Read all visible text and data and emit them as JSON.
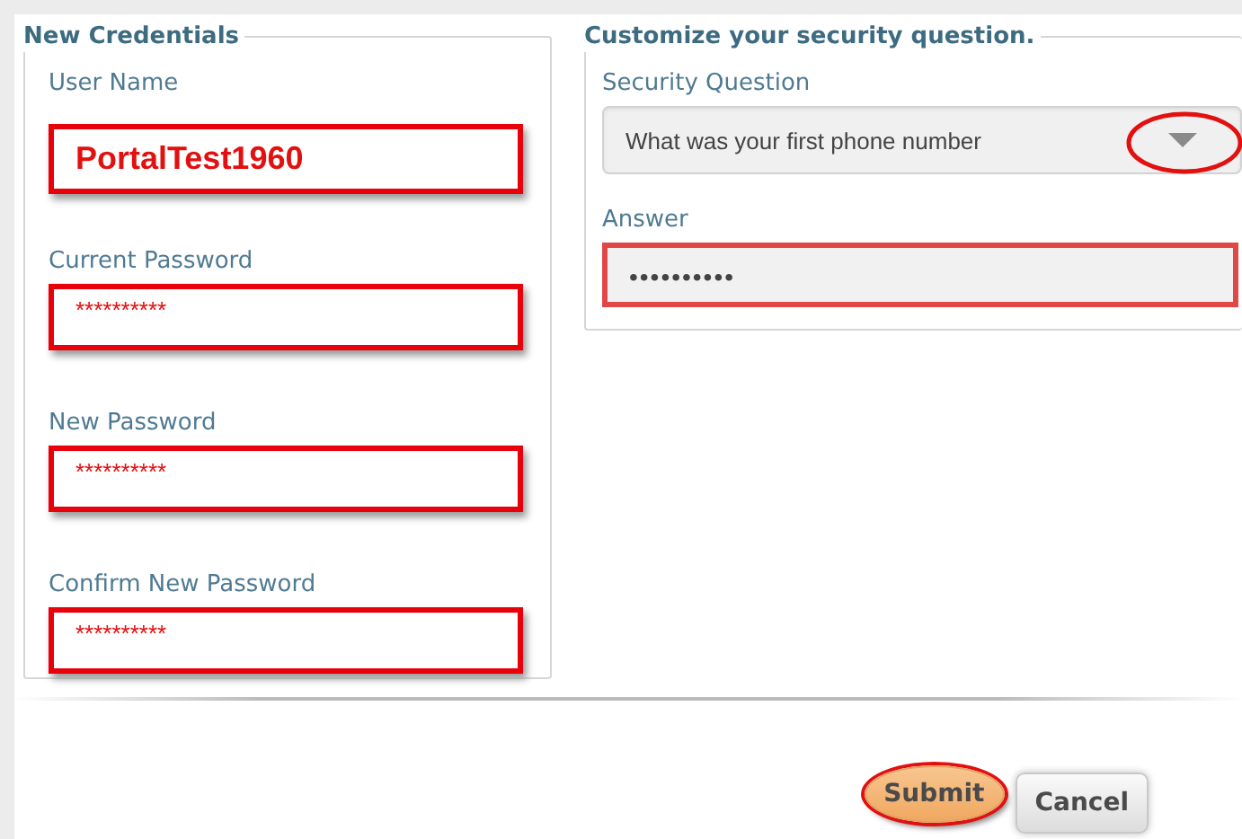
{
  "credentials": {
    "legend": "New Credentials",
    "fields": [
      {
        "label": "User Name",
        "value": "PortalTest1960",
        "kind": "username",
        "highlighted": true
      },
      {
        "label": "Current Password",
        "value": "**********",
        "kind": "password",
        "highlighted": true
      },
      {
        "label": "New Password",
        "value": "**********",
        "kind": "password",
        "highlighted": true
      },
      {
        "label": "Confirm New Password",
        "value": "**********",
        "kind": "password",
        "highlighted": true
      }
    ]
  },
  "security": {
    "legend": "Customize your security question.",
    "question": {
      "label": "Security Question",
      "value": "What was your first phone number",
      "highlighted": true
    },
    "answer": {
      "label": "Answer",
      "value": "••••••••••",
      "highlighted": true
    }
  },
  "buttons": [
    {
      "label": "Submit",
      "kind": "primary",
      "highlighted": true
    },
    {
      "label": "Cancel",
      "kind": "secondary",
      "highlighted": false
    }
  ]
}
